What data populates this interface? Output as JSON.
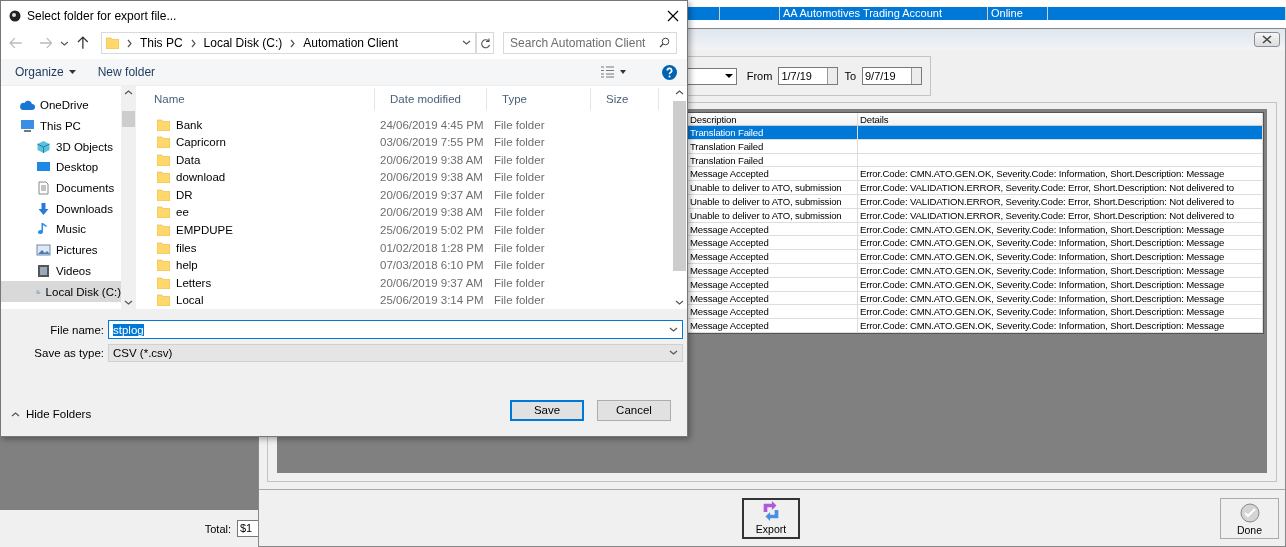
{
  "background_window": {
    "list_rows": [
      {
        "account": "AA Automotives Trading Account",
        "media": "Online",
        "selected": true
      }
    ],
    "total_label": "Total:",
    "total_value": "$1"
  },
  "log_window": {
    "from_label": "From",
    "from_date": "1/7/19",
    "to_label": "To",
    "to_date": "9/7/19",
    "table": {
      "columns": [
        "Description",
        "Details"
      ],
      "rows": [
        {
          "description": "Translation Failed",
          "details": "",
          "selected": true
        },
        {
          "description": "Translation Failed",
          "details": "",
          "selected": false
        },
        {
          "description": "Translation Failed",
          "details": "",
          "selected": false
        },
        {
          "description": "Message Accepted",
          "details": "Error.Code: CMN.ATO.GEN.OK, Severity.Code: Information, Short.Description: Message",
          "selected": false
        },
        {
          "description": "Unable to deliver to ATO, submission",
          "details": "Error.Code: VALIDATION.ERROR, Severity.Code: Error, Short.Description: Not delivered to",
          "selected": false
        },
        {
          "description": "Unable to deliver to ATO, submission",
          "details": "Error.Code: VALIDATION.ERROR, Severity.Code: Error, Short.Description: Not delivered to",
          "selected": false
        },
        {
          "description": "Unable to deliver to ATO, submission",
          "details": "Error.Code: VALIDATION.ERROR, Severity.Code: Error, Short.Description: Not delivered to",
          "selected": false
        },
        {
          "description": "Message Accepted",
          "details": "Error.Code: CMN.ATO.GEN.OK, Severity.Code: Information, Short.Description: Message",
          "selected": false
        },
        {
          "description": "Message Accepted",
          "details": "Error.Code: CMN.ATO.GEN.OK, Severity.Code: Information, Short.Description: Message",
          "selected": false
        },
        {
          "description": "Message Accepted",
          "details": "Error.Code: CMN.ATO.GEN.OK, Severity.Code: Information, Short.Description: Message",
          "selected": false
        },
        {
          "description": "Message Accepted",
          "details": "Error.Code: CMN.ATO.GEN.OK, Severity.Code: Information, Short.Description: Message",
          "selected": false
        },
        {
          "description": "Message Accepted",
          "details": "Error.Code: CMN.ATO.GEN.OK, Severity.Code: Information, Short.Description: Message",
          "selected": false
        },
        {
          "description": "Message Accepted",
          "details": "Error.Code: CMN.ATO.GEN.OK, Severity.Code: Information, Short.Description: Message",
          "selected": false
        },
        {
          "description": "Message Accepted",
          "details": "Error.Code: CMN.ATO.GEN.OK, Severity.Code: Information, Short.Description: Message",
          "selected": false
        },
        {
          "description": "Message Accepted",
          "details": "Error.Code: CMN.ATO.GEN.OK, Severity.Code: Information, Short.Description: Message",
          "selected": false
        }
      ]
    },
    "buttons": [
      {
        "label": "Export",
        "kind": "export"
      },
      {
        "label": "Done",
        "kind": "done"
      }
    ]
  },
  "file_dialog": {
    "title": "Select folder for export file...",
    "breadcrumb": [
      "This PC",
      "Local Disk (C:)",
      "Automation Client"
    ],
    "search": {
      "placeholder": "Search Automation Client"
    },
    "toolbar": [
      {
        "label": "Organize",
        "kind": "menu"
      },
      {
        "label": "New folder",
        "kind": "plain"
      }
    ],
    "nav": [
      {
        "label": "OneDrive",
        "kind": "cloud",
        "selected": false
      },
      {
        "label": "This PC",
        "kind": "pc",
        "selected": false,
        "children": [
          {
            "label": "3D Objects",
            "kind": "cube",
            "selected": false
          },
          {
            "label": "Desktop",
            "kind": "desktop",
            "selected": false
          },
          {
            "label": "Documents",
            "kind": "documents",
            "selected": false
          },
          {
            "label": "Downloads",
            "kind": "downloads",
            "selected": false
          },
          {
            "label": "Music",
            "kind": "music",
            "selected": false
          },
          {
            "label": "Pictures",
            "kind": "pictures",
            "selected": false
          },
          {
            "label": "Videos",
            "kind": "videos",
            "selected": false
          },
          {
            "label": "Local Disk (C:)",
            "kind": "drive",
            "selected": true
          }
        ]
      }
    ],
    "columns": [
      "Name",
      "Date modified",
      "Type",
      "Size"
    ],
    "files": [
      {
        "name": "Bank",
        "date": "24/06/2019 4:45 PM",
        "type": "File folder"
      },
      {
        "name": "Capricorn",
        "date": "03/06/2019 7:55 PM",
        "type": "File folder"
      },
      {
        "name": "Data",
        "date": "20/06/2019 9:38 AM",
        "type": "File folder"
      },
      {
        "name": "download",
        "date": "20/06/2019 9:38 AM",
        "type": "File folder"
      },
      {
        "name": "DR",
        "date": "20/06/2019 9:37 AM",
        "type": "File folder"
      },
      {
        "name": "ee",
        "date": "20/06/2019 9:38 AM",
        "type": "File folder"
      },
      {
        "name": "EMPDUPE",
        "date": "25/06/2019 5:02 PM",
        "type": "File folder"
      },
      {
        "name": "files",
        "date": "01/02/2018 1:28 PM",
        "type": "File folder"
      },
      {
        "name": "help",
        "date": "07/03/2018 6:10 PM",
        "type": "File folder"
      },
      {
        "name": "Letters",
        "date": "20/06/2019 9:37 AM",
        "type": "File folder"
      },
      {
        "name": "Local",
        "date": "25/06/2019 3:14 PM",
        "type": "File folder"
      }
    ],
    "file_name_label": "File name:",
    "file_name": "stplog",
    "file_name_selected": true,
    "type_label": "Save as type:",
    "type_value": "CSV (*.csv)",
    "hide_folders": "Hide Folders",
    "buttons": [
      {
        "label": "Save",
        "default": true
      },
      {
        "label": "Cancel",
        "default": false
      }
    ]
  }
}
